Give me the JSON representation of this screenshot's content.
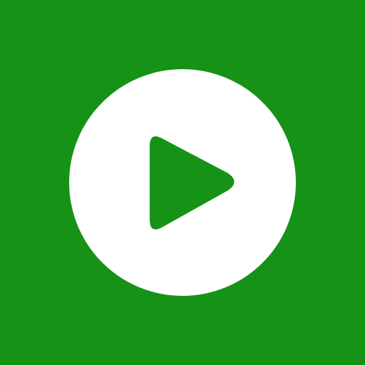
{
  "icon": {
    "name": "play-icon",
    "background_color": "#169216",
    "circle_color": "#ffffff",
    "triangle_color": "#169216"
  }
}
